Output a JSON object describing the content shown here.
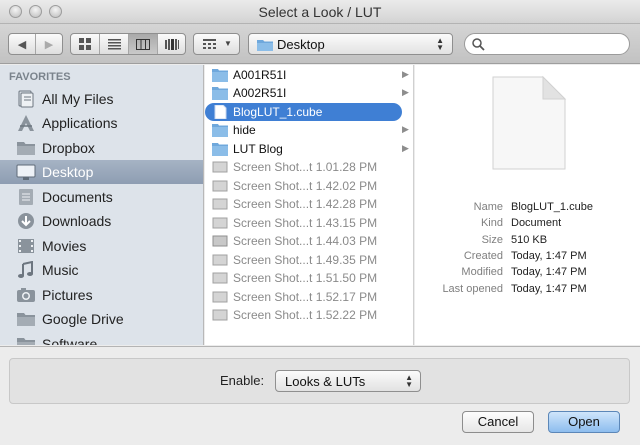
{
  "window": {
    "title": "Select a Look / LUT"
  },
  "toolbar": {
    "location": "Desktop",
    "search": {
      "value": "",
      "placeholder": ""
    }
  },
  "sidebar": {
    "heading": "FAVORITES",
    "selected_index": 4,
    "items": [
      {
        "label": "All My Files",
        "icon": "all-files-icon"
      },
      {
        "label": "Applications",
        "icon": "applications-icon"
      },
      {
        "label": "Dropbox",
        "icon": "folder-icon"
      },
      {
        "label": "Desktop",
        "icon": "desktop-icon"
      },
      {
        "label": "Documents",
        "icon": "documents-icon"
      },
      {
        "label": "Downloads",
        "icon": "downloads-icon"
      },
      {
        "label": "Movies",
        "icon": "movies-icon"
      },
      {
        "label": "Music",
        "icon": "music-icon"
      },
      {
        "label": "Pictures",
        "icon": "pictures-icon"
      },
      {
        "label": "Google Drive",
        "icon": "folder-icon"
      },
      {
        "label": "Software",
        "icon": "folder-icon"
      }
    ]
  },
  "files": [
    {
      "name": "A001R51I",
      "kind": "folder",
      "enabled": true
    },
    {
      "name": "A002R51I",
      "kind": "folder",
      "enabled": true
    },
    {
      "name": "BlogLUT_1.cube",
      "kind": "file",
      "enabled": true,
      "selected": true
    },
    {
      "name": "hide",
      "kind": "folder",
      "enabled": true
    },
    {
      "name": "LUT Blog",
      "kind": "folder",
      "enabled": true
    },
    {
      "name": "Screen Shot...t 1.01.28 PM",
      "kind": "image",
      "enabled": false
    },
    {
      "name": "Screen Shot...t 1.42.02 PM",
      "kind": "image",
      "enabled": false
    },
    {
      "name": "Screen Shot...t 1.42.28 PM",
      "kind": "image",
      "enabled": false
    },
    {
      "name": "Screen Shot...t 1.43.15 PM",
      "kind": "image",
      "enabled": false
    },
    {
      "name": "Screen Shot...t 1.44.03 PM",
      "kind": "image",
      "enabled": false
    },
    {
      "name": "Screen Shot...t 1.49.35 PM",
      "kind": "image",
      "enabled": false
    },
    {
      "name": "Screen Shot...t 1.51.50 PM",
      "kind": "image",
      "enabled": false
    },
    {
      "name": "Screen Shot...t 1.52.17 PM",
      "kind": "image",
      "enabled": false
    },
    {
      "name": "Screen Shot...t 1.52.22 PM",
      "kind": "image",
      "enabled": false
    }
  ],
  "preview": {
    "info": [
      {
        "key": "Name",
        "value": "BlogLUT_1.cube"
      },
      {
        "key": "Kind",
        "value": "Document"
      },
      {
        "key": "Size",
        "value": "510 KB"
      },
      {
        "key": "Created",
        "value": "Today, 1:47 PM"
      },
      {
        "key": "Modified",
        "value": "Today, 1:47 PM"
      },
      {
        "key": "Last opened",
        "value": "Today, 1:47 PM"
      }
    ]
  },
  "footer": {
    "enable_label": "Enable:",
    "enable_value": "Looks & LUTs",
    "cancel_label": "Cancel",
    "open_label": "Open"
  },
  "colors": {
    "selection_blue": "#3f7fd4",
    "sidebar_selection": "#9aa8bb",
    "sidebar_bg": "#dde3ea",
    "folder_blue": "#6fa8dc"
  }
}
